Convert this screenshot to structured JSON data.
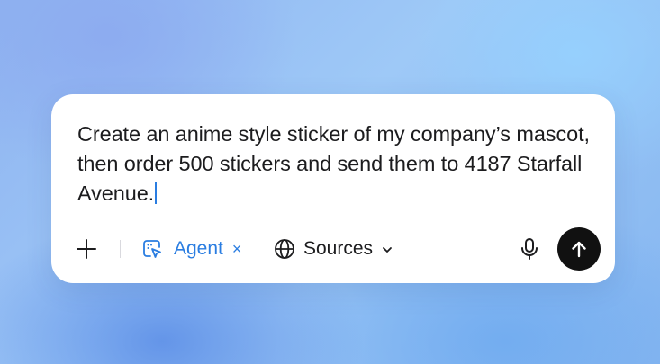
{
  "composer": {
    "prompt_text": "Create an anime style sticker of my company’s mascot, then order 500 stickers and send them to 4187 Starfall Avenue.",
    "accent_color": "#2a7de1"
  },
  "toolbar": {
    "add_icon": "plus-icon",
    "agent_label": "Agent",
    "agent_icon": "agent-cursor-icon",
    "agent_remove": "×",
    "sources_label": "Sources",
    "sources_icon": "globe-icon",
    "sources_chevron": "chevron-down-icon",
    "mic_icon": "microphone-icon",
    "send_icon": "arrow-up-icon",
    "send_button_color": "#111111"
  }
}
